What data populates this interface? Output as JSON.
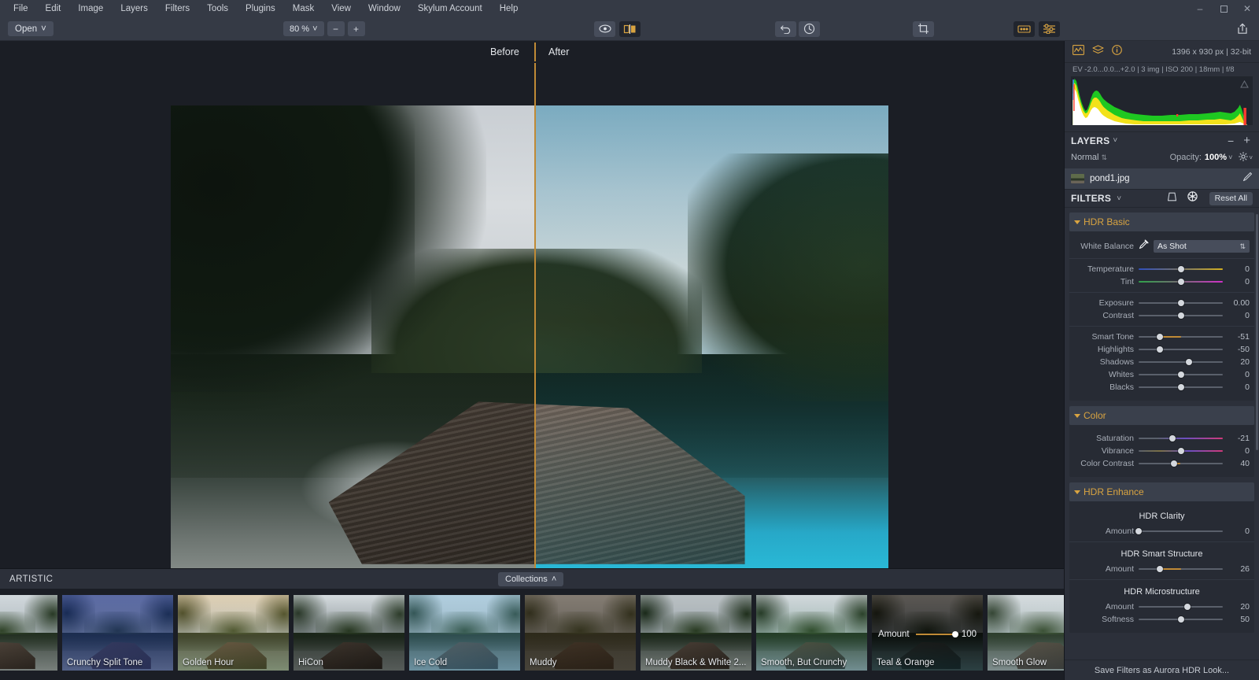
{
  "app": {
    "title": "Aurora HDR"
  },
  "menubar": {
    "items": [
      {
        "label": "File"
      },
      {
        "label": "Edit"
      },
      {
        "label": "Image"
      },
      {
        "label": "Layers"
      },
      {
        "label": "Filters"
      },
      {
        "label": "Tools"
      },
      {
        "label": "Plugins"
      },
      {
        "label": "Mask"
      },
      {
        "label": "View"
      },
      {
        "label": "Window"
      },
      {
        "label": "Skylum Account"
      },
      {
        "label": "Help"
      }
    ],
    "window_controls": {
      "minimize": "–",
      "maximize": "❐",
      "close": "✕"
    }
  },
  "toolbar": {
    "open_label": "Open",
    "open_caret": "˅",
    "zoom_value": "80 %",
    "zoom_caret": "˅",
    "zoom_out": "−",
    "zoom_in": "+",
    "icons": {
      "preview_eye": "eye-icon",
      "compare_split": "split-compare-icon",
      "undo": "undo-icon",
      "history": "history-icon",
      "crop": "crop-icon",
      "presets_grid": "presets-grid-icon",
      "adjust_sliders": "adjust-sliders-icon",
      "share": "share-icon"
    }
  },
  "canvas": {
    "before_label": "Before",
    "after_label": "After"
  },
  "presets": {
    "category": "ARTISTIC",
    "collections_label": "Collections",
    "collections_caret": "˄",
    "amount_label": "Amount",
    "amount_value": "100",
    "items": [
      {
        "label": "",
        "selected": false
      },
      {
        "label": "Crunchy Split Tone",
        "selected": false
      },
      {
        "label": "Golden Hour",
        "selected": false
      },
      {
        "label": "HiCon",
        "selected": false
      },
      {
        "label": "Ice Cold",
        "selected": false
      },
      {
        "label": "Muddy",
        "selected": false
      },
      {
        "label": "Muddy Black & White 2...",
        "selected": false
      },
      {
        "label": "Smooth, But Crunchy",
        "selected": false
      },
      {
        "label": "Teal & Orange",
        "selected": true
      },
      {
        "label": "Smooth Glow",
        "selected": false
      }
    ]
  },
  "right_panel": {
    "histogram": {
      "dimensions": "1396 x 930 px  |  32-bit",
      "metadata": "EV -2.0...0.0...+2.0  |  3 img  |  ISO 200  |  18mm  |  f/8",
      "icons": {
        "histogram": "histogram-icon",
        "layers_stack": "layers-stack-icon",
        "info": "info-icon"
      }
    },
    "layers": {
      "title": "LAYERS",
      "caret": "˅",
      "remove": "−",
      "add": "+",
      "blend_mode": "Normal",
      "blend_caret": "⇅",
      "opacity_label": "Opacity:",
      "opacity_value": "100%",
      "opacity_caret": "˅",
      "settings_icon": "gear-icon",
      "layer_name": "pond1.jpg",
      "layer_edit_icon": "brush-icon"
    },
    "filters": {
      "title": "FILTERS",
      "caret": "˅",
      "reset_label": "Reset All",
      "mask_icon": "mask-icon",
      "settings_icon": "filter-settings-icon",
      "groups": [
        {
          "name": "HDR Basic",
          "white_balance": {
            "label": "White Balance",
            "value": "As Shot",
            "eyedropper_icon": "eyedropper-icon",
            "caret": "⇅"
          },
          "sections": [
            {
              "sliders": [
                {
                  "label": "Temperature",
                  "value": "0",
                  "pos": 50,
                  "track": "temp"
                },
                {
                  "label": "Tint",
                  "value": "0",
                  "pos": 50,
                  "track": "tint"
                }
              ]
            },
            {
              "sliders": [
                {
                  "label": "Exposure",
                  "value": "0.00",
                  "pos": 50,
                  "track": ""
                },
                {
                  "label": "Contrast",
                  "value": "0",
                  "pos": 50,
                  "track": ""
                }
              ]
            },
            {
              "sliders": [
                {
                  "label": "Smart Tone",
                  "value": "-51",
                  "pos": 25,
                  "track": "",
                  "fill_from_center": true
                },
                {
                  "label": "Highlights",
                  "value": "-50",
                  "pos": 25,
                  "track": ""
                },
                {
                  "label": "Shadows",
                  "value": "20",
                  "pos": 60,
                  "track": ""
                },
                {
                  "label": "Whites",
                  "value": "0",
                  "pos": 50,
                  "track": ""
                },
                {
                  "label": "Blacks",
                  "value": "0",
                  "pos": 50,
                  "track": ""
                }
              ]
            }
          ]
        },
        {
          "name": "Color",
          "sections": [
            {
              "sliders": [
                {
                  "label": "Saturation",
                  "value": "-21",
                  "pos": 40,
                  "track": "sat"
                },
                {
                  "label": "Vibrance",
                  "value": "0",
                  "pos": 50,
                  "track": "vib"
                },
                {
                  "label": "Color Contrast",
                  "value": "40",
                  "pos": 42,
                  "track": "",
                  "fill_from_center": true
                }
              ]
            }
          ]
        },
        {
          "name": "HDR Enhance",
          "sections": [
            {
              "header": "HDR Clarity",
              "sliders": [
                {
                  "label": "Amount",
                  "value": "0",
                  "pos": 0,
                  "track": ""
                }
              ]
            },
            {
              "header": "HDR Smart Structure",
              "sliders": [
                {
                  "label": "Amount",
                  "value": "26",
                  "pos": 25,
                  "track": "",
                  "fill_from_center": true
                }
              ]
            },
            {
              "header": "HDR Microstructure",
              "sliders": [
                {
                  "label": "Amount",
                  "value": "20",
                  "pos": 58,
                  "track": ""
                },
                {
                  "label": "Softness",
                  "value": "50",
                  "pos": 50,
                  "track": "",
                  "fill_from_center": true
                }
              ]
            }
          ]
        }
      ]
    },
    "save_look_label": "Save Filters as Aurora HDR Look..."
  },
  "colors": {
    "accent": "#d9a441",
    "split_line": "#c08a36",
    "panel_bg": "#2c303a",
    "canvas_bg": "#1b1e25"
  }
}
